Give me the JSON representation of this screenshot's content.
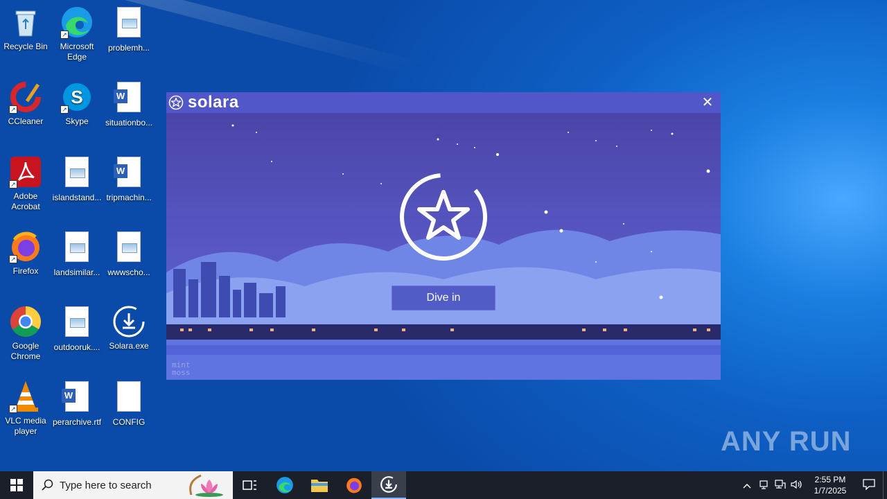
{
  "desktop": {
    "icons": [
      {
        "label": "Recycle Bin"
      },
      {
        "label": "Microsoft Edge"
      },
      {
        "label": "problemh..."
      },
      {
        "label": "CCleaner"
      },
      {
        "label": "Skype"
      },
      {
        "label": "situationbo..."
      },
      {
        "label": "Adobe Acrobat"
      },
      {
        "label": "islandstand..."
      },
      {
        "label": "tripmachin..."
      },
      {
        "label": "Firefox"
      },
      {
        "label": "landsimilar..."
      },
      {
        "label": "wwwscho..."
      },
      {
        "label": "Google Chrome"
      },
      {
        "label": "outdooruk...."
      },
      {
        "label": "Solara.exe"
      },
      {
        "label": "VLC media player"
      },
      {
        "label": "perarchive.rtf"
      },
      {
        "label": "CONFIG"
      }
    ]
  },
  "solara": {
    "title": "solara",
    "close": "✕",
    "button": "Dive in",
    "corner_text": "mint\nmoss"
  },
  "watermark": {
    "text": "ANY RUN"
  },
  "taskbar": {
    "search_placeholder": "Type here to search",
    "time": "2:55 PM",
    "date": "1/7/2025"
  }
}
